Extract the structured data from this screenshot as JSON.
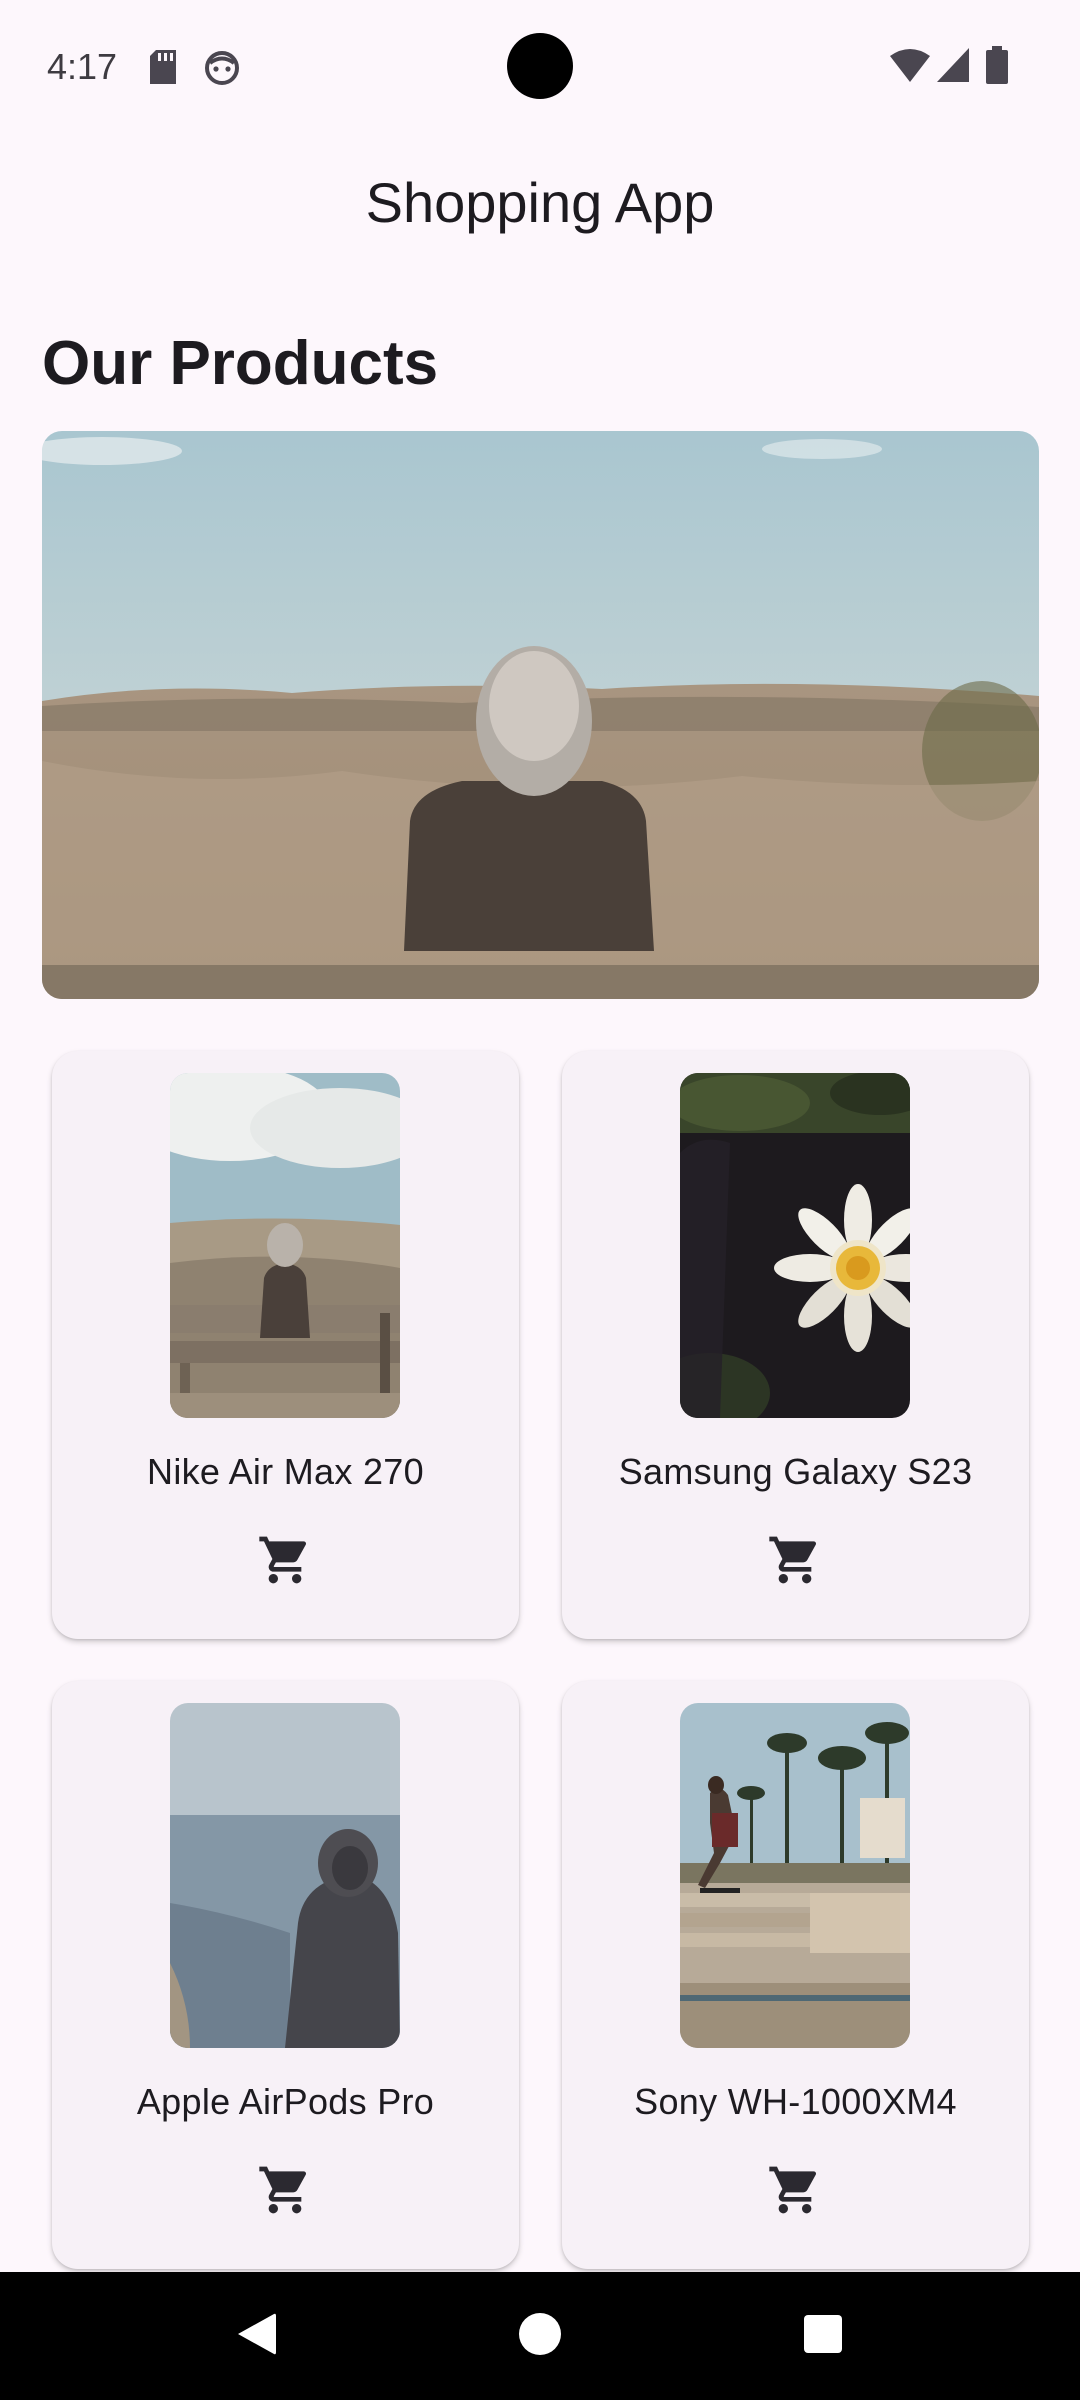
{
  "status_bar": {
    "time": "4:17",
    "icons": [
      "sd-card-icon",
      "android-face-icon",
      "wifi-icon",
      "cellular-signal-icon",
      "battery-icon"
    ]
  },
  "app_bar": {
    "title": "Shopping App"
  },
  "section": {
    "title": "Our Products"
  },
  "products": [
    {
      "name": "Nike Air Max 270",
      "image": "person-on-bench-dunes"
    },
    {
      "name": "Samsung Galaxy S23",
      "image": "white-water-lily"
    },
    {
      "name": "Apple AirPods Pro",
      "image": "hooded-person-by-sea"
    },
    {
      "name": "Sony WH-1000XM4",
      "image": "skateboarder-palm-trees"
    }
  ],
  "nav_bar": {
    "buttons": [
      "back-icon",
      "home-icon",
      "recents-icon"
    ]
  },
  "colors": {
    "background": "#fdf7fc",
    "card": "#f7f1f7",
    "text": "#1d1b20"
  }
}
